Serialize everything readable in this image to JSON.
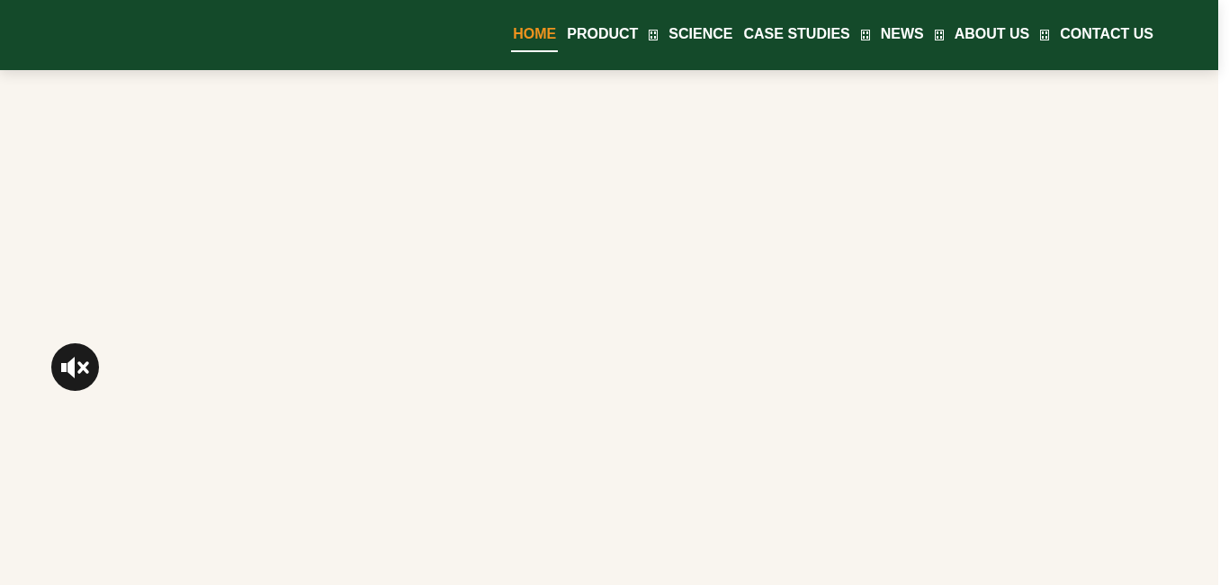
{
  "nav": {
    "items": [
      {
        "label": "HOME",
        "selected": true,
        "has_dropdown": false
      },
      {
        "label": "PRODUCT",
        "selected": false,
        "has_dropdown": true
      },
      {
        "label": "SCIENCE",
        "selected": false,
        "has_dropdown": false
      },
      {
        "label": "CASE STUDIES",
        "selected": false,
        "has_dropdown": true
      },
      {
        "label": "NEWS",
        "selected": false,
        "has_dropdown": true
      },
      {
        "label": "ABOUT US",
        "selected": false,
        "has_dropdown": true
      },
      {
        "label": "CONTACT US",
        "selected": false,
        "has_dropdown": false
      }
    ]
  },
  "sound": {
    "muted": true
  }
}
